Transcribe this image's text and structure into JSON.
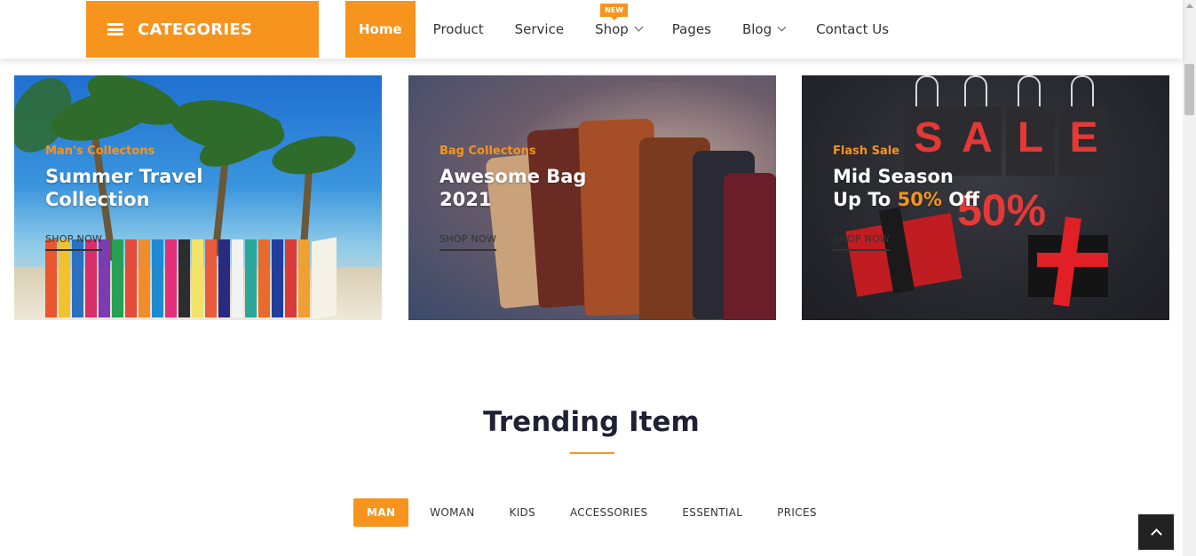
{
  "nav": {
    "categories_label": "CATEGORIES",
    "items": [
      {
        "label": "Home",
        "active": true
      },
      {
        "label": "Product"
      },
      {
        "label": "Service"
      },
      {
        "label": "Shop",
        "badge": "NEW",
        "dropdown": true
      },
      {
        "label": "Pages"
      },
      {
        "label": "Blog",
        "dropdown": true
      },
      {
        "label": "Contact Us"
      }
    ]
  },
  "banners": [
    {
      "eyebrow": "Man's Collectons",
      "title_line1": "Summer Travel",
      "title_line2": "Collection",
      "cta": "SHOP NOW"
    },
    {
      "eyebrow": "Bag Collectons",
      "title_line1": "Awesome Bag",
      "title_line2": "2021",
      "cta": "SHOP NOW"
    },
    {
      "eyebrow": "Flash Sale",
      "title_line1": "Mid Season",
      "title_line2_pre": "Up To ",
      "title_line2_hl": "50%",
      "title_line2_post": " Off",
      "cta": "SHOP NOW",
      "image_text": {
        "sale": [
          "S",
          "A",
          "L",
          "E"
        ],
        "percent": "50%"
      }
    }
  ],
  "trending": {
    "title": "Trending Item",
    "tabs": [
      "MAN",
      "WOMAN",
      "KIDS",
      "ACCESSORIES",
      "ESSENTIAL",
      "PRICES"
    ]
  },
  "colors": {
    "accent": "#f7941d",
    "dark": "#1f2233"
  },
  "icons": {
    "menu": "hamburger-icon",
    "dropdown": "chevron-down-icon",
    "back_to_top": "chevron-up-icon"
  }
}
